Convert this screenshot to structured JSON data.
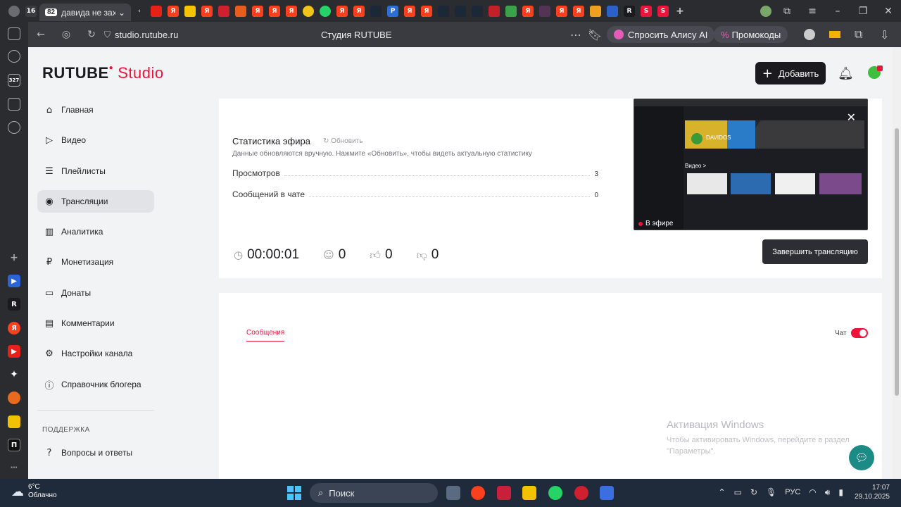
{
  "browser": {
    "active_tab": {
      "count": "16",
      "badge": "82",
      "title": "давида не захади"
    },
    "url": "studio.rutube.ru",
    "page_title": "Студия RUTUBE",
    "alice_pill": "Спросить Алису AI",
    "promo_pill": "Промокоды"
  },
  "header": {
    "logo_main": "RUTUBE",
    "logo_studio": "Studio",
    "add_button": "Добавить"
  },
  "nav": {
    "items": [
      {
        "label": "Главная",
        "icon": "home-icon"
      },
      {
        "label": "Видео",
        "icon": "video-icon"
      },
      {
        "label": "Плейлисты",
        "icon": "playlist-icon"
      },
      {
        "label": "Трансляции",
        "icon": "broadcast-icon",
        "active": true
      },
      {
        "label": "Аналитика",
        "icon": "chart-icon"
      },
      {
        "label": "Монетизация",
        "icon": "money-icon"
      },
      {
        "label": "Донаты",
        "icon": "wallet-icon"
      },
      {
        "label": "Комментарии",
        "icon": "comment-icon"
      },
      {
        "label": "Настройки канала",
        "icon": "gear-icon"
      },
      {
        "label": "Справочник блогера",
        "icon": "info-icon"
      }
    ],
    "support_section": "ПОДДЕРЖКА",
    "support_items": [
      {
        "label": "Вопросы и ответы",
        "icon": "question-icon"
      }
    ]
  },
  "stats": {
    "title": "Статистика эфира",
    "refresh": "Обновить",
    "description": "Данные обновляются вручную. Нажмите «Обновить», чтобы видеть актуальную статистику",
    "rows": [
      {
        "label": "Просмотров",
        "value": "3"
      },
      {
        "label": "Сообщений в чате",
        "value": "0"
      }
    ],
    "duration": "00:00:01",
    "viewers": "0",
    "likes": "0",
    "dislikes": "0",
    "end_button": "Завершить трансляцию",
    "preview_live_label": "В эфире",
    "preview_channel": "DAVIDOS",
    "preview_section": "Видео >"
  },
  "chat": {
    "tab_messages": "Сообщения",
    "toggle_label": "Чат",
    "toggle_on": true
  },
  "watermark": {
    "title": "Активация Windows",
    "text": "Чтобы активировать Windows, перейдите в раздел \"Параметры\"."
  },
  "taskbar": {
    "temp": "6°C",
    "weather": "Облачно",
    "search": "Поиск",
    "lang": "РУС",
    "time": "17:07",
    "date": "29.10.2025"
  },
  "colors": {
    "accent": "#ed143b",
    "dark_button": "#1b1b1f",
    "help_button": "#1d8b85"
  }
}
